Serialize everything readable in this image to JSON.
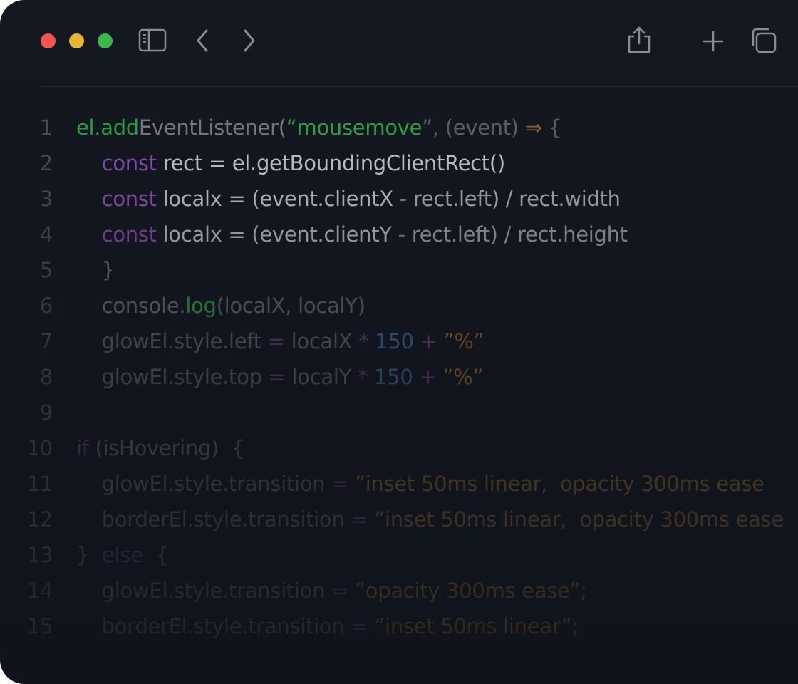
{
  "colors": {
    "window_bg": "#13171f",
    "close": "#f2564e",
    "minimize": "#e9b336",
    "maximize": "#3db64a",
    "icon": "#878c96",
    "green": "#2fa044",
    "purple": "#7b3f9c",
    "blue": "#2b5f8a",
    "orange": "#8a6420",
    "text_light": "#bcc1cb",
    "text_dim": "#4e5360",
    "line_number": "#3d4250"
  },
  "toolbar": {
    "icons": [
      "sidebar-icon",
      "back-icon",
      "forward-icon",
      "share-icon",
      "plus-icon",
      "copy-icon"
    ]
  },
  "code": {
    "line_numbers": [
      "1",
      "2",
      "3",
      "4",
      "5",
      "6",
      "7",
      "8",
      "9",
      "10",
      "11",
      "12",
      "13",
      "14",
      "15"
    ],
    "lines": [
      [
        {
          "t": "el.add",
          "c": "#2aa142"
        },
        {
          "t": "EventListener(",
          "c": "#767b86"
        },
        {
          "t": "“mousemove",
          "c": "#31a342"
        },
        {
          "t": "”, (event) ",
          "c": "#5c616c"
        },
        {
          "t": "⇒",
          "c": "#8c6a2a"
        },
        {
          "t": " {",
          "c": "#5c616c"
        }
      ],
      [
        {
          "t": "    const",
          "c": "#8a4fb0"
        },
        {
          "t": " rect = el.getBoundingClientRect()",
          "c": "#c3c7cf"
        }
      ],
      [
        {
          "t": "    const",
          "c": "#8a4fb0"
        },
        {
          "t": " localx = (event.clientX ",
          "c": "#b9bec7"
        },
        {
          "t": "-",
          "c": "#7d828c"
        },
        {
          "t": " rect.left) / rect.width",
          "c": "#a3a8b2"
        }
      ],
      [
        {
          "t": "    const",
          "c": "#7a4699"
        },
        {
          "t": " localx = (event.clientY ",
          "c": "#a7acb5"
        },
        {
          "t": "-",
          "c": "#6f747e"
        },
        {
          "t": " rect.left) / rect.height",
          "c": "#8d929c"
        }
      ],
      [
        {
          "t": "    }",
          "c": "#5f6470"
        }
      ],
      [
        {
          "t": "    console.",
          "c": "#5b606b"
        },
        {
          "t": "log",
          "c": "#2a8c3c"
        },
        {
          "t": "(localX, localY)",
          "c": "#575c67"
        }
      ],
      [
        {
          "t": "    glowEl.style.left ",
          "c": "#4f5460"
        },
        {
          "t": "=",
          "c": "#55336a"
        },
        {
          "t": " localX ",
          "c": "#4f5460"
        },
        {
          "t": "*",
          "c": "#55336a"
        },
        {
          "t": " 150 ",
          "c": "#2e5c80"
        },
        {
          "t": "+",
          "c": "#55336a"
        },
        {
          "t": " ”%”",
          "c": "#7a5a24"
        }
      ],
      [
        {
          "t": "    glowEl.style.top ",
          "c": "#4b505c"
        },
        {
          "t": "=",
          "c": "#52316a"
        },
        {
          "t": " localY ",
          "c": "#4b505c"
        },
        {
          "t": "*",
          "c": "#52316a"
        },
        {
          "t": " 150 ",
          "c": "#2c587a"
        },
        {
          "t": "+",
          "c": "#52316a"
        },
        {
          "t": " ”%”",
          "c": "#755623"
        }
      ],
      [],
      [
        {
          "t": "if",
          "c": "#4c2d61"
        },
        {
          "t": " (isHovering)  {",
          "c": "#454a55"
        }
      ],
      [
        {
          "t": "    glowEl.style.transition ",
          "c": "#3f4450"
        },
        {
          "t": "=",
          "c": "#4a2c5e"
        },
        {
          "t": " ”inset 50ms linear,  opacity 300ms ease",
          "c": "#5f4a22"
        }
      ],
      [
        {
          "t": "    borderEl.style.transition ",
          "c": "#3d424d"
        },
        {
          "t": "=",
          "c": "#482b5b"
        },
        {
          "t": " ”inset 50ms linear,  opacity 300ms ease",
          "c": "#5c4721"
        }
      ],
      [
        {
          "t": "}  ",
          "c": "#3b404b"
        },
        {
          "t": "else",
          "c": "#452a58"
        },
        {
          "t": "  {",
          "c": "#3b404b"
        }
      ],
      [
        {
          "t": "    glowEl.style.transition ",
          "c": "#393e49"
        },
        {
          "t": "=",
          "c": "#422855"
        },
        {
          "t": " ”opacity 300ms ease”;",
          "c": "#574420"
        }
      ],
      [
        {
          "t": "    borderEl.style.transition ",
          "c": "#373c47"
        },
        {
          "t": "=",
          "c": "#402753"
        },
        {
          "t": " ”inset 50ms linear”;",
          "c": "#54411f"
        }
      ]
    ]
  }
}
